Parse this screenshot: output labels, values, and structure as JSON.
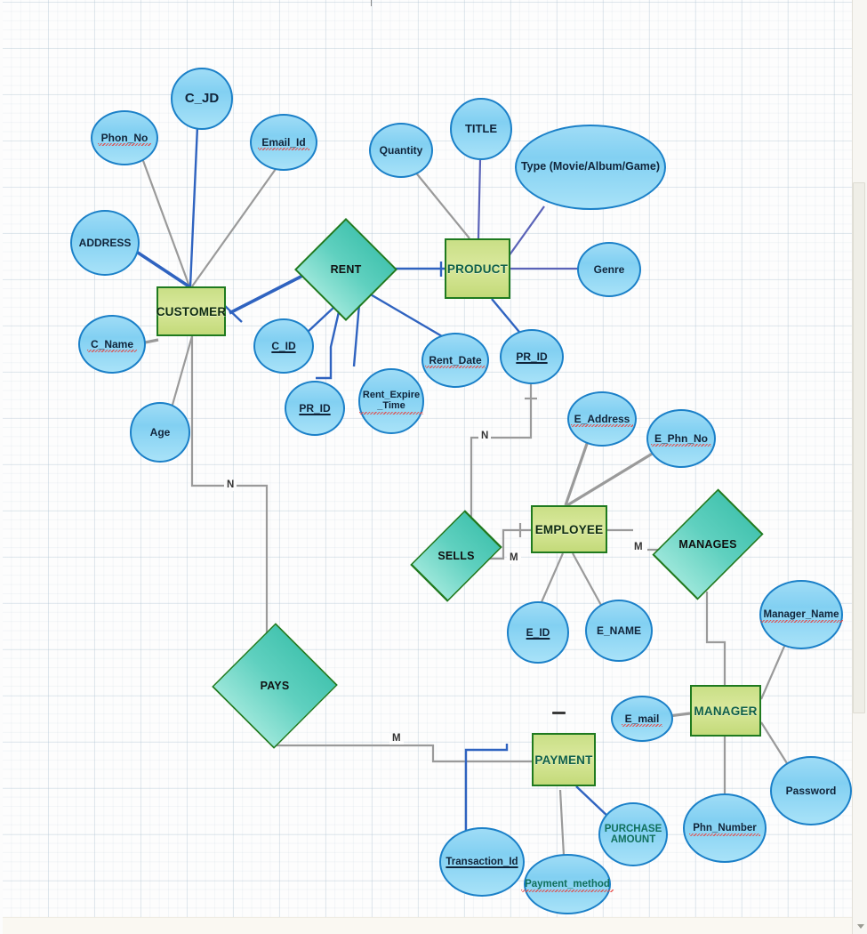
{
  "diagram": {
    "title": "ER Diagram",
    "colors": {
      "entity_fill": "#d9e89c",
      "entity_border": "#1f7a1f",
      "relationship_fill": "#5fd0bf",
      "relationship_border": "#1f7a1f",
      "attribute_fill": "#82d0f2",
      "attribute_border": "#1b80c8",
      "connector_gray": "#9a9a9a",
      "connector_blue": "#2f63c0",
      "spellcheck_underline": "#e8433f"
    },
    "entities": [
      {
        "id": "customer",
        "label": "CUSTOMER"
      },
      {
        "id": "product",
        "label": "PRODUCT"
      },
      {
        "id": "employee",
        "label": "EMPLOYEE"
      },
      {
        "id": "manager",
        "label": "MANAGER"
      },
      {
        "id": "payment",
        "label": "PAYMENT"
      }
    ],
    "relationships": [
      {
        "id": "rent",
        "label": "RENT"
      },
      {
        "id": "sells",
        "label": "SELLS"
      },
      {
        "id": "manages",
        "label": "MANAGES"
      },
      {
        "id": "pays",
        "label": "PAYS"
      }
    ],
    "attributes": [
      {
        "id": "phon_no",
        "label": "Phon_No",
        "owner": "customer",
        "key": false,
        "misspelled": true
      },
      {
        "id": "c_jd",
        "label": "C_JD",
        "owner": "customer",
        "key": false,
        "misspelled": false
      },
      {
        "id": "email_id",
        "label": "Email_Id",
        "owner": "customer",
        "key": false,
        "misspelled": true
      },
      {
        "id": "address",
        "label": "ADDRESS",
        "owner": "customer",
        "key": false,
        "misspelled": false
      },
      {
        "id": "c_name",
        "label": "C_Name",
        "owner": "customer",
        "key": false,
        "misspelled": true
      },
      {
        "id": "age",
        "label": "Age",
        "owner": "customer",
        "key": false,
        "misspelled": false
      },
      {
        "id": "quantity",
        "label": "Quantity",
        "owner": "product",
        "key": false,
        "misspelled": false
      },
      {
        "id": "title",
        "label": "TITLE",
        "owner": "product",
        "key": false,
        "misspelled": false
      },
      {
        "id": "type",
        "label": "Type (Movie/Album/Game)",
        "owner": "product",
        "key": false,
        "misspelled": false
      },
      {
        "id": "genre",
        "label": "Genre",
        "owner": "product",
        "key": false,
        "misspelled": false
      },
      {
        "id": "pr_id_product",
        "label": "PR_ID",
        "owner": "product",
        "key": true,
        "misspelled": false
      },
      {
        "id": "rent_c_id",
        "label": "C_ID",
        "owner": "rent",
        "key": true,
        "misspelled": false
      },
      {
        "id": "rent_pr_id",
        "label": "PR_ID",
        "owner": "rent",
        "key": true,
        "misspelled": false
      },
      {
        "id": "rent_expire",
        "label": "Rent_Expire _Time",
        "owner": "rent",
        "key": false,
        "misspelled": true
      },
      {
        "id": "rent_date",
        "label": "Rent_Date",
        "owner": "rent",
        "key": false,
        "misspelled": true
      },
      {
        "id": "e_address",
        "label": "E_Address",
        "owner": "employee",
        "key": false,
        "misspelled": true
      },
      {
        "id": "e_phn_no",
        "label": "E_Phn_No",
        "owner": "employee",
        "key": false,
        "misspelled": true
      },
      {
        "id": "e_id",
        "label": "E_ID",
        "owner": "employee",
        "key": true,
        "misspelled": false
      },
      {
        "id": "e_name",
        "label": "E_NAME",
        "owner": "employee",
        "key": false,
        "misspelled": false
      },
      {
        "id": "manager_name",
        "label": "Manager_Name",
        "owner": "manager",
        "key": false,
        "misspelled": true
      },
      {
        "id": "e_mail",
        "label": "E_mail",
        "owner": "manager",
        "key": false,
        "misspelled": true
      },
      {
        "id": "password",
        "label": "Password",
        "owner": "manager",
        "key": false,
        "misspelled": false
      },
      {
        "id": "phn_number",
        "label": "Phn_Number",
        "owner": "manager",
        "key": false,
        "misspelled": true
      },
      {
        "id": "transaction_id",
        "label": "Transaction_Id",
        "owner": "payment",
        "key": true,
        "misspelled": true
      },
      {
        "id": "purchase_amount",
        "label": "PURCHASE AMOUNT",
        "owner": "payment",
        "key": false,
        "misspelled": false
      },
      {
        "id": "payment_method",
        "label": "Payment_method",
        "owner": "payment",
        "key": false,
        "misspelled": true
      }
    ],
    "cardinalities": [
      {
        "id": "customer_pays_n",
        "label": "N"
      },
      {
        "id": "pays_payment_m",
        "label": "M"
      },
      {
        "id": "product_sells_n",
        "label": "N"
      },
      {
        "id": "sells_employee_m",
        "label": "M"
      },
      {
        "id": "employee_manages_m",
        "label": "M"
      }
    ],
    "text_lines": {
      "purchase_amount_line1": "PURCHASE",
      "purchase_amount_line2": "AMOUNT",
      "rent_expire_line1": "Rent_Expire",
      "rent_expire_line2": "_Time"
    }
  }
}
